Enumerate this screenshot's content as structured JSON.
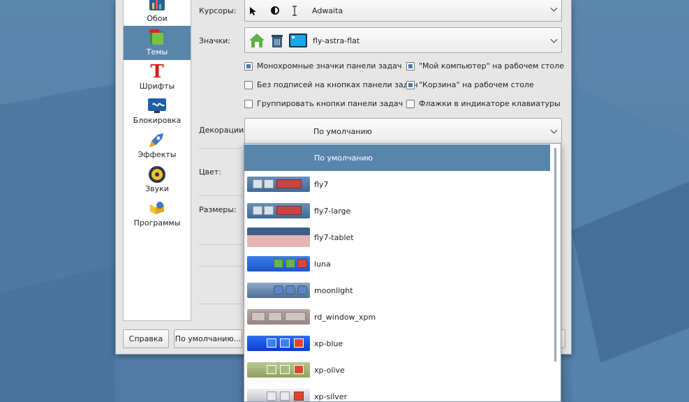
{
  "colors": {
    "accent": "#5a85ab",
    "desktop": "#5a84aa",
    "window_bg": "#e6e6e6"
  },
  "sidebar": {
    "items": [
      {
        "label": "Обои",
        "icon": "wallpaper-icon"
      },
      {
        "label": "Темы",
        "icon": "themes-icon",
        "active": true
      },
      {
        "label": "Шрифты",
        "icon": "fonts-icon"
      },
      {
        "label": "Блокировка",
        "icon": "lock-screen-icon"
      },
      {
        "label": "Эффекты",
        "icon": "effects-rocket-icon"
      },
      {
        "label": "Звуки",
        "icon": "sounds-icon"
      },
      {
        "label": "Программы",
        "icon": "programs-icon"
      }
    ]
  },
  "form": {
    "cursors_label": "Курсоры:",
    "cursors_value": "Adwaita",
    "icons_label": "Значки:",
    "icons_value": "fly-astra-flat",
    "decorations_label": "Декорации:",
    "decorations_value": "По умолчанию",
    "color_label": "Цвет:",
    "sizes_label": "Размеры:"
  },
  "checkboxes": [
    {
      "label": "Монохромные значки панели задач",
      "checked": true
    },
    {
      "label": "\"Мой компьютер\" на рабочем столе",
      "checked": true
    },
    {
      "label": "Без подписей на кнопках панели задач",
      "checked": false
    },
    {
      "label": "\"Корзина\" на рабочем столе",
      "checked": true
    },
    {
      "label": "Группировать кнопки панели задач",
      "checked": false
    },
    {
      "label": "Флажки в индикаторе клавиатуры",
      "checked": false
    }
  ],
  "buttons": {
    "help": "Справка",
    "defaults": "По умолчанию..."
  },
  "dropdown": {
    "options": [
      {
        "label": "По умолчанию",
        "selected": true
      },
      {
        "label": "fly7"
      },
      {
        "label": "fly7-large"
      },
      {
        "label": "fly7-tablet"
      },
      {
        "label": "luna"
      },
      {
        "label": "moonlight"
      },
      {
        "label": "rd_window_xpm"
      },
      {
        "label": "xp-blue"
      },
      {
        "label": "xp-olive"
      },
      {
        "label": "xp-silver"
      }
    ]
  }
}
